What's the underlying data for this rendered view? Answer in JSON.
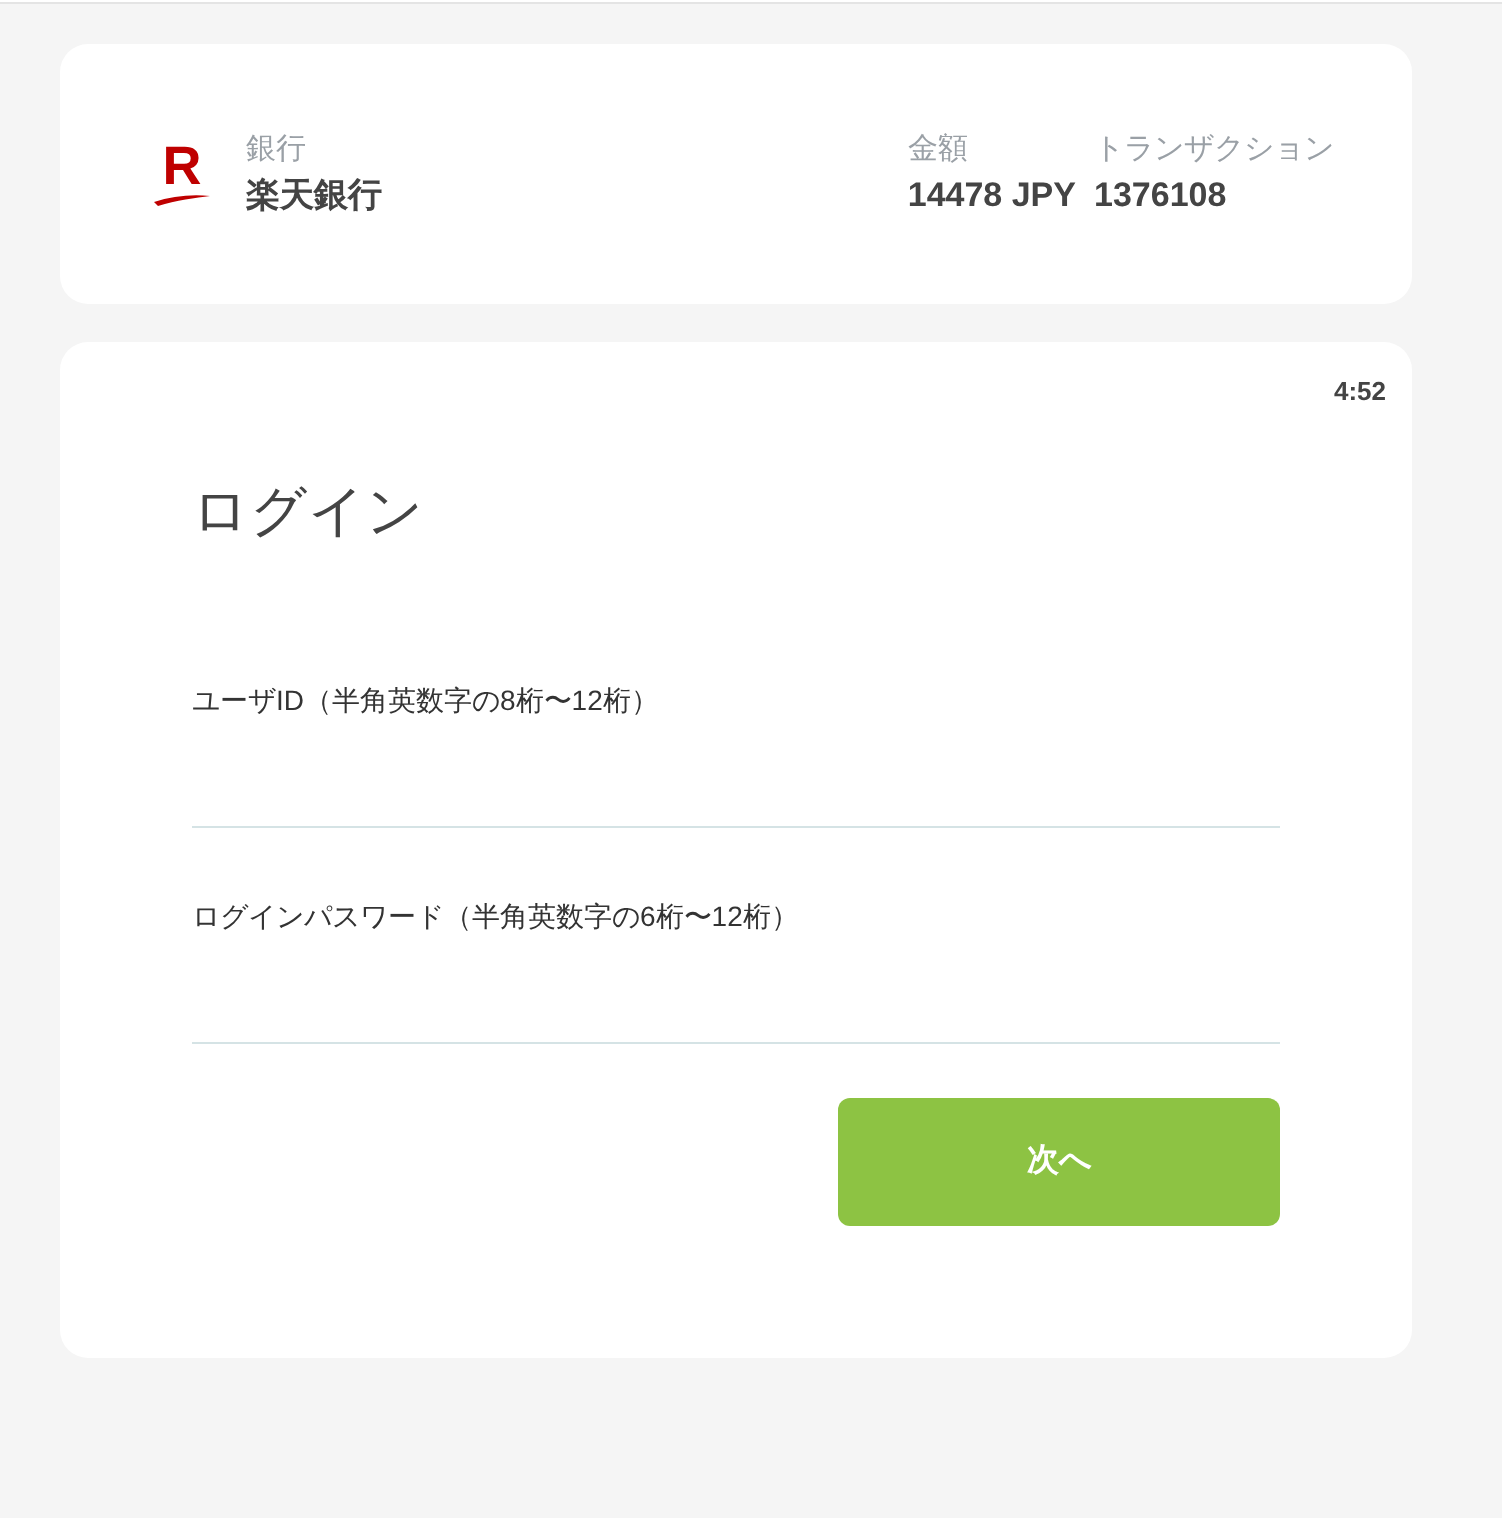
{
  "header": {
    "logo_text": "R",
    "bank": {
      "label": "銀行",
      "value": "楽天銀行"
    },
    "details": [
      {
        "label": "金額",
        "value": "14478 JPY"
      },
      {
        "label": "トランザクション",
        "value": "1376108"
      }
    ]
  },
  "login": {
    "timer": "4:52",
    "title": "ログイン",
    "fields": [
      {
        "label": "ユーザID（半角英数字の8桁〜12桁）"
      },
      {
        "label": "ログインパスワード（半角英数字の6桁〜12桁）"
      }
    ],
    "button": "次へ"
  }
}
